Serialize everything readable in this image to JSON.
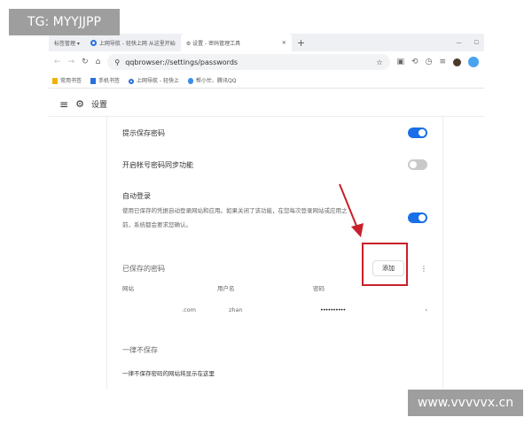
{
  "watermarks": {
    "top": "TG: MYYJJPP",
    "bottom": "www.vvvvvx.cn"
  },
  "tabs": [
    {
      "label": "标签管理 ▾"
    },
    {
      "label": "上网导航 - 轻快上网 从这里开始"
    },
    {
      "label": "设置 - 密码管理工具",
      "active": true
    }
  ],
  "new_tab": "+",
  "address": {
    "url": "qqbrowser://settings/passwords"
  },
  "bookmarks": [
    "常用书签",
    "手机书签",
    "上网导航 - 轻快上",
    "帮小忙、腾讯QQ"
  ],
  "settings_header": {
    "title": "设置"
  },
  "settings": {
    "offer_save": {
      "label": "提示保存密码",
      "enabled": true
    },
    "sync": {
      "label": "开启帐号密码同步功能",
      "enabled": false
    },
    "auto_login": {
      "label": "自动登录",
      "desc1": "使用已保存的凭据自动登录网站和应用。如果关闭了该功能，在您每次登录网站或应用之",
      "desc2": "前，系统都会要求您确认。",
      "enabled": true
    }
  },
  "saved": {
    "title": "已保存的密码",
    "add_label": "添加",
    "columns": [
      "网站",
      "用户名",
      "密码"
    ],
    "rows": [
      {
        "site": ".com",
        "user": "zhan",
        "password": "••••••••••"
      }
    ]
  },
  "never": {
    "title": "一律不保存",
    "empty": "一律不保存密码的网站将显示在这里"
  },
  "colors": {
    "accent": "#1a6fe8",
    "highlight": "#c8202a"
  }
}
